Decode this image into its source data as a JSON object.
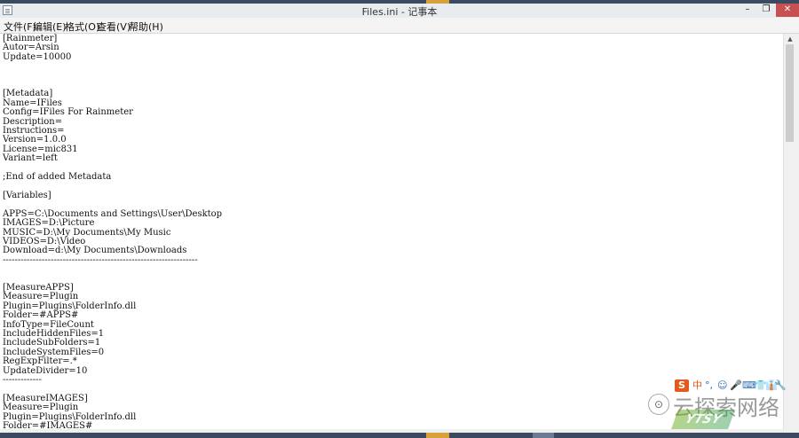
{
  "window": {
    "title": "Files.ini - 记事本",
    "buttons": {
      "minimize": "–",
      "maximize": "❐",
      "close": "✕"
    }
  },
  "menu": [
    "文件(F)",
    "编辑(E)",
    "格式(O)",
    "查看(V)",
    "帮助(H)"
  ],
  "editor": {
    "content": "[Rainmeter]\nAutor=Arsin\nUpdate=10000\n\n\n\n[Metadata]\nName=IFiles\nConfig=IFiles For Rainmeter\nDescription=\nInstructions=\nVersion=1.0.0\nLicense=mic831\nVariant=left\n\n;End of added Metadata\n\n[Variables]\n\nAPPS=C:\\Documents and Settings\\User\\Desktop\nIMAGES=D:\\Picture\nMUSIC=D:\\My Documents\\My Music\nVIDEOS=D:\\Video\nDownload=d:\\My Documents\\Downloads\n-----------------------------------------------------------------\n\n\n[MeasureAPPS]\nMeasure=Plugin\nPlugin=Plugins\\FolderInfo.dll\nFolder=#APPS#\nInfoType=FileCount\nIncludeHiddenFiles=1\nIncludeSubFolders=1\nIncludeSystemFiles=0\nRegExpFilter=.*\nUpdateDivider=10\n-------------\n\n[MeasureIMAGES]\nMeasure=Plugin\nPlugin=Plugins\\FolderInfo.dll\nFolder=#IMAGES#"
  },
  "scrollbar": {
    "up_arrow": "▲"
  },
  "ime": {
    "logo": "S",
    "items": [
      "中",
      "°,",
      "☺",
      "🎤",
      "⌨",
      "👕",
      "👔",
      "🔧"
    ]
  },
  "watermark": {
    "wechat_icon": "⊙",
    "text": "云探索网络",
    "logo_text": "YTSY"
  }
}
